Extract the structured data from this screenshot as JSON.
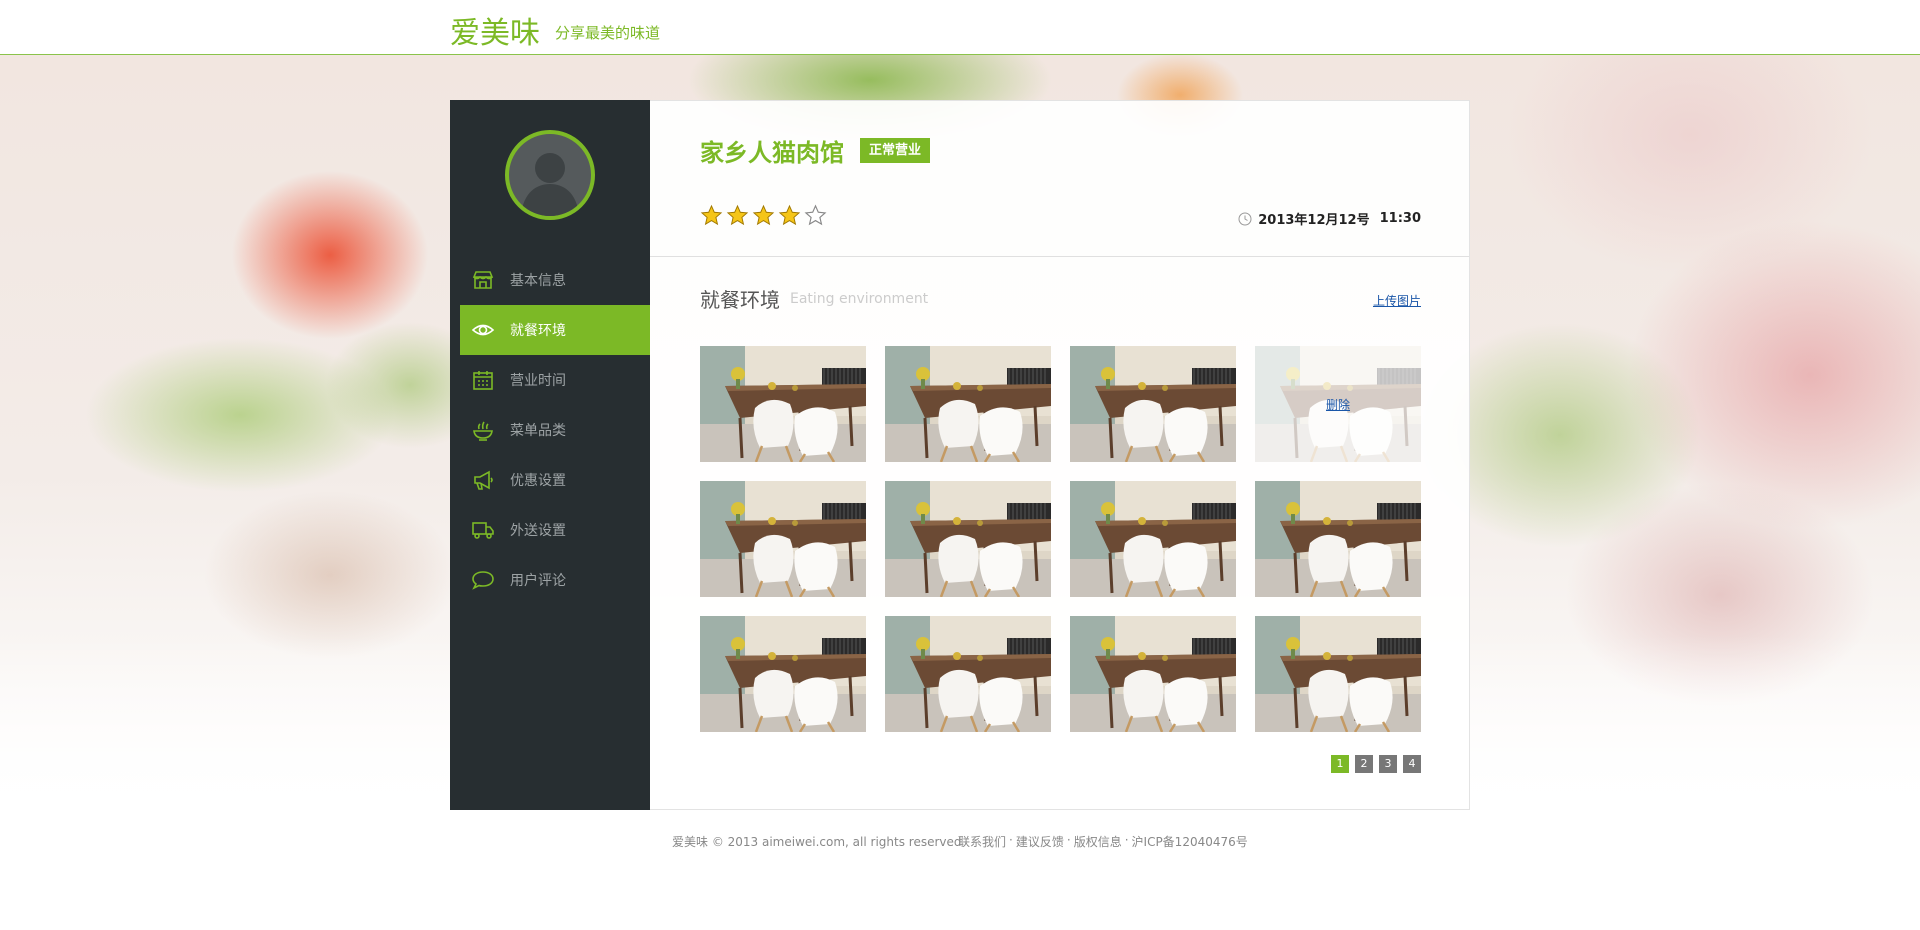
{
  "header": {
    "logo": "爱美味",
    "slogan": "分享最美的味道"
  },
  "sidebar": {
    "items": [
      {
        "label": "基本信息",
        "icon": "store-icon"
      },
      {
        "label": "就餐环境",
        "icon": "eye-icon"
      },
      {
        "label": "营业时间",
        "icon": "calendar-icon"
      },
      {
        "label": "菜单品类",
        "icon": "food-bowl-icon"
      },
      {
        "label": "优惠设置",
        "icon": "megaphone-icon"
      },
      {
        "label": "外送设置",
        "icon": "truck-icon"
      },
      {
        "label": "用户评论",
        "icon": "chat-bubble-icon"
      }
    ],
    "active_index": 1
  },
  "shop": {
    "name": "家乡人猫肉馆",
    "status": "正常营业",
    "rating": 4,
    "rating_max": 5,
    "date": "2013年12月12号",
    "time": "11:30"
  },
  "section": {
    "title": "就餐环境",
    "subtitle": "Eating environment",
    "upload_label": "上传图片",
    "delete_label": "删除"
  },
  "pagination": {
    "pages": [
      "1",
      "2",
      "3",
      "4"
    ],
    "current": "1"
  },
  "footer": {
    "copyright": "爱美味 © 2013 aimeiwei.com, all rights reserved",
    "links": [
      "联系我们",
      "建议反馈",
      "版权信息",
      "沪ICP备12040476号"
    ],
    "separator": "·"
  },
  "colors": {
    "accent": "#7cb926",
    "sidebar_bg": "#272e31",
    "link": "#1a56a8"
  }
}
